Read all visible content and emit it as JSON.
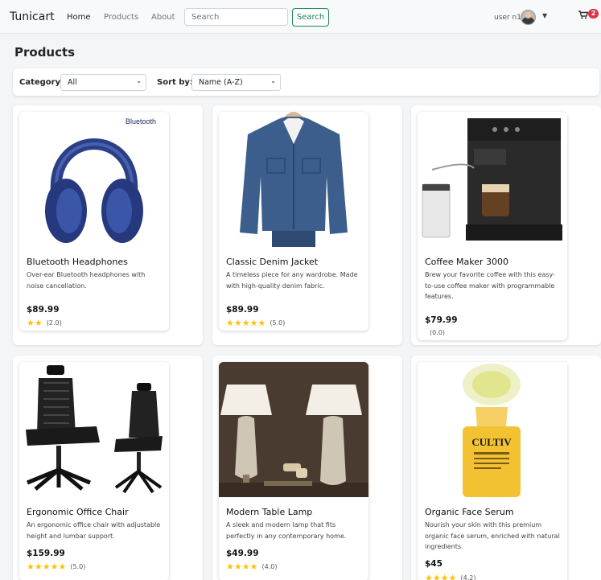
{
  "navbar": {
    "brand": "Tunicart",
    "links": [
      "Home",
      "Products",
      "About"
    ],
    "search_placeholder": "Search",
    "search_button": "Search",
    "user": "user n1",
    "cart_count": "2"
  },
  "page": {
    "title": "Products",
    "filters": {
      "category_label": "Category:",
      "category_value": "All",
      "sort_label": "Sort by:",
      "sort_value": "Name (A-Z)"
    }
  },
  "products": [
    {
      "name": "Bluetooth Headphones",
      "description": "Over-ear Bluetooth headphones with noise cancellation.",
      "price": "$89.99",
      "rating": 2,
      "rating_text": "(2.0)",
      "image_icon": "headphones-image",
      "image_label": "Bluetooth"
    },
    {
      "name": "Classic Denim Jacket",
      "description": "A timeless piece for any wardrobe. Made with high-quality denim fabric.",
      "price": "$89.99",
      "rating": 5,
      "rating_text": "(5.0)",
      "image_icon": "denim-jacket-image"
    },
    {
      "name": "Coffee Maker 3000",
      "description": "Brew your favorite coffee with this easy-to-use coffee maker with programmable features.",
      "price": "$79.99",
      "rating": 0,
      "rating_text": "(0.0)",
      "image_icon": "coffee-maker-image"
    },
    {
      "name": "Ergonomic Office Chair",
      "description": "An ergonomic office chair with adjustable height and lumbar support.",
      "price": "$159.99",
      "rating": 5,
      "rating_text": "(5.0)",
      "image_icon": "office-chair-image"
    },
    {
      "name": "Modern Table Lamp",
      "description": "A sleek and modern lamp that fits perfectly in any contemporary home.",
      "price": "$49.99",
      "rating": 4,
      "rating_text": "(4.0)",
      "image_icon": "table-lamp-image"
    },
    {
      "name": "Organic Face Serum",
      "description": "Nourish your skin with this premium organic face serum, enriched with natural ingredients.",
      "price": "$45",
      "rating": 4,
      "rating_text": "(4.2)",
      "image_icon": "face-serum-image",
      "image_label": "CULTIV"
    }
  ],
  "colors": {
    "star": "#ffc107",
    "search_button": "#198754",
    "cart_badge": "#dc3545"
  }
}
